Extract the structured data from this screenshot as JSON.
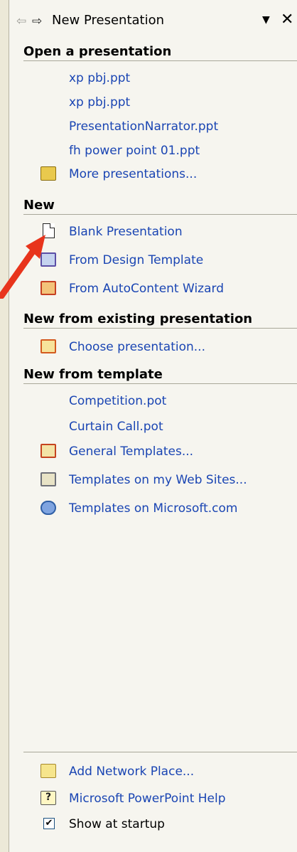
{
  "header": {
    "back_glyph": "⇦",
    "forward_glyph": "⇨",
    "title": "New Presentation",
    "dropdown_glyph": "▼",
    "close_glyph": "✕"
  },
  "open_section": {
    "heading": "Open a presentation",
    "files": [
      "xp pbj.ppt",
      "xp pbj.ppt",
      "PresentationNarrator.ppt",
      "fh power point 01.ppt"
    ],
    "more_label": "More presentations..."
  },
  "new_section": {
    "heading": "New",
    "items": [
      {
        "label": "Blank Presentation",
        "icon": "blank-document-icon"
      },
      {
        "label": "From Design Template",
        "icon": "design-template-icon"
      },
      {
        "label": "From AutoContent Wizard",
        "icon": "autocontent-wizard-icon"
      }
    ]
  },
  "existing_section": {
    "heading": "New from existing presentation",
    "choose_label": "Choose presentation..."
  },
  "template_section": {
    "heading": "New from template",
    "recent": [
      "Competition.pot",
      "Curtain Call.pot"
    ],
    "items": [
      {
        "label": "General Templates...",
        "icon": "general-templates-icon"
      },
      {
        "label": "Templates on my Web Sites...",
        "icon": "web-sites-icon"
      },
      {
        "label": "Templates on Microsoft.com",
        "icon": "globe-icon"
      }
    ]
  },
  "footer": {
    "add_network_place": "Add Network Place...",
    "help_label": "Microsoft PowerPoint Help",
    "help_glyph": "?",
    "show_at_startup": "Show at startup",
    "show_at_startup_checked": true,
    "check_glyph": "✔"
  },
  "colors": {
    "link": "#1a45b3",
    "pane_background": "#f6f5ef",
    "annotation_arrow": "#e8341c"
  }
}
